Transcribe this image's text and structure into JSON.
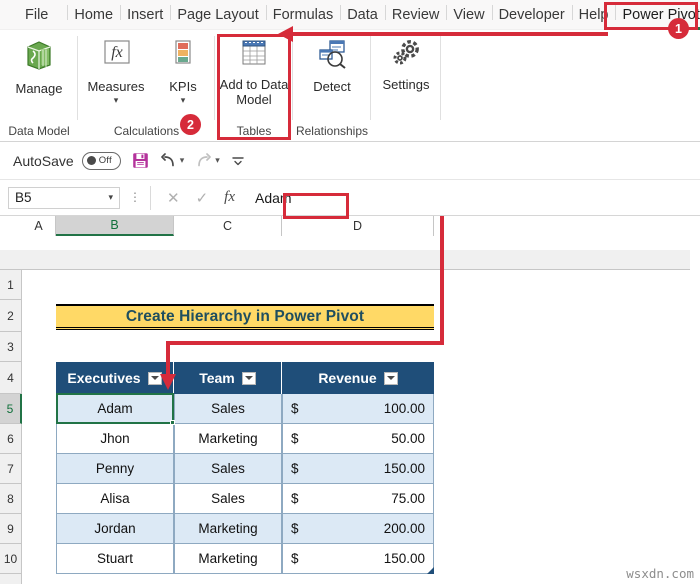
{
  "ribbon": {
    "tabs": [
      {
        "label": "File",
        "active": false
      },
      {
        "label": "Home",
        "active": false
      },
      {
        "label": "Insert",
        "active": false
      },
      {
        "label": "Page Layout",
        "active": false
      },
      {
        "label": "Formulas",
        "active": false
      },
      {
        "label": "Data",
        "active": false
      },
      {
        "label": "Review",
        "active": false
      },
      {
        "label": "View",
        "active": false
      },
      {
        "label": "Developer",
        "active": false
      },
      {
        "label": "Help",
        "active": false
      },
      {
        "label": "Power Pivot",
        "active": true
      }
    ],
    "groups": [
      {
        "name": "Data Model",
        "label": "Data Model"
      },
      {
        "name": "Calculations",
        "label": "Calculations"
      },
      {
        "name": "Tables",
        "label": "Tables"
      },
      {
        "name": "Relationships",
        "label": "Relationships"
      },
      {
        "name": "Settings",
        "label": ""
      }
    ],
    "buttons": {
      "manage": {
        "label": "Manage",
        "icon": "manage-datamodel-icon"
      },
      "measures": {
        "label": "Measures",
        "icon": "fx-measures-icon"
      },
      "kpis": {
        "label": "KPIs",
        "icon": "kpi-icon"
      },
      "add_to_data_model": {
        "label": "Add to Data Model",
        "icon": "table-grid-icon"
      },
      "detect": {
        "label": "Detect",
        "icon": "detect-relationships-icon"
      },
      "settings": {
        "label": "Settings",
        "icon": "gear-icon"
      }
    }
  },
  "quick_access": {
    "autosave_label": "AutoSave",
    "autosave_state": "Off",
    "save_icon": "save-disk-icon",
    "undo_icon": "undo-arrow-icon",
    "redo_icon": "redo-arrow-icon",
    "customize_icon": "customize-qat-icon"
  },
  "formula_bar": {
    "name_box_value": "B5",
    "cancel_icon": "cancel-x-icon",
    "enter_icon": "enter-check-icon",
    "fx_icon": "insert-function-icon",
    "formula_value": "Adam"
  },
  "sheet": {
    "columns": [
      "A",
      "B",
      "C",
      "D"
    ],
    "selected_column": "B",
    "rows": [
      "1",
      "2",
      "3",
      "4",
      "5",
      "6",
      "7",
      "8",
      "9",
      "10"
    ],
    "selected_row": "5",
    "banner_title": "Create Hierarchy in Power Pivot",
    "banner_color": "#ffd966",
    "table": {
      "header_color": "#1f4e79",
      "band_color": "#dce9f5",
      "headers": [
        "Executives",
        "Team",
        "Revenue"
      ],
      "rows": [
        {
          "executive": "Adam",
          "team": "Sales",
          "currency": "$",
          "revenue": "100.00"
        },
        {
          "executive": "Jhon",
          "team": "Marketing",
          "currency": "$",
          "revenue": "50.00"
        },
        {
          "executive": "Penny",
          "team": "Sales",
          "currency": "$",
          "revenue": "150.00"
        },
        {
          "executive": "Alisa",
          "team": "Sales",
          "currency": "$",
          "revenue": "75.00"
        },
        {
          "executive": "Jordan",
          "team": "Marketing",
          "currency": "$",
          "revenue": "200.00"
        },
        {
          "executive": "Stuart",
          "team": "Marketing",
          "currency": "$",
          "revenue": "150.00"
        }
      ]
    }
  },
  "annotations": {
    "accent_color": "#d62b3a",
    "badge_1": "1",
    "badge_2": "2"
  },
  "watermark": "wsxdn.com"
}
